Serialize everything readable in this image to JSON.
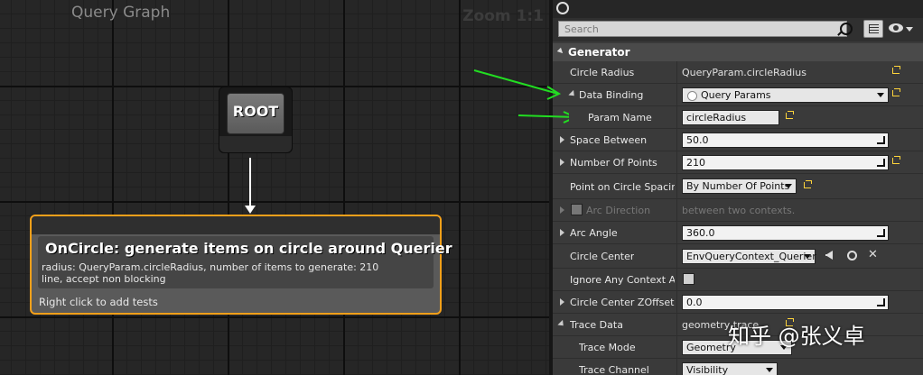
{
  "graph": {
    "title": "Query Graph",
    "zoom": "Zoom 1:1"
  },
  "root": {
    "label": "ROOT"
  },
  "generator_node": {
    "title": "OnCircle: generate items on circle around Querier",
    "description": "radius: QueryParam.circleRadius, number of items to generate: 210\nline, accept non blocking",
    "footer": "Right click to add tests"
  },
  "details": {
    "search_placeholder": "Search",
    "category": "Generator",
    "rows": [
      {
        "label": "Circle Radius",
        "value": "QueryParam.circleRadius"
      },
      {
        "label": "Data Binding",
        "value": "Query Params"
      },
      {
        "label": "Param Name",
        "value": "circleRadius"
      },
      {
        "label": "Space Between",
        "value": "50.0"
      },
      {
        "label": "Number Of Points",
        "value": "210"
      },
      {
        "label": "Point on Circle Spacing",
        "value": "By Number Of Points"
      },
      {
        "label": "Arc Direction",
        "value": "between two contexts."
      },
      {
        "label": "Arc Angle",
        "value": "360.0"
      },
      {
        "label": "Circle Center",
        "value": "EnvQueryContext_Querier"
      },
      {
        "label": "Ignore Any Context Actor",
        "value": ""
      },
      {
        "label": "Circle Center ZOffset",
        "value": "0.0"
      },
      {
        "label": "Trace Data",
        "value": "geometry trace"
      },
      {
        "label": "Trace Mode",
        "value": "Geometry"
      },
      {
        "label": "Trace Channel",
        "value": "Visibility"
      }
    ]
  },
  "watermark": "知乎 @张义卓",
  "colors": {
    "node_border": "#f5a01a",
    "annotation_arrow": "#22dd22",
    "reset_icon": "#ffd43b"
  }
}
